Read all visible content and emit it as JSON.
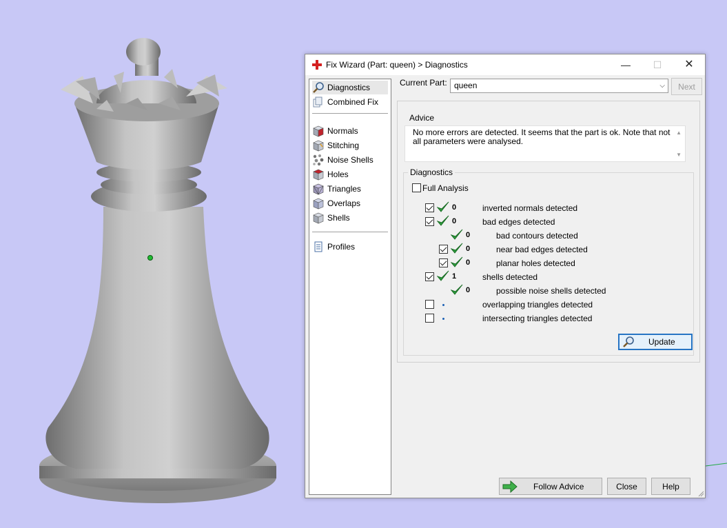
{
  "window": {
    "title": "Fix Wizard (Part: queen) > Diagnostics",
    "minimize_glyph": "—",
    "maximize_glyph": "☐",
    "close_glyph": "✕"
  },
  "nav": {
    "items": [
      {
        "label": "Diagnostics",
        "icon": "magnifier-icon",
        "selected": true
      },
      {
        "label": "Combined Fix",
        "icon": "layers-icon"
      },
      {
        "label": "Normals",
        "icon": "cube-red-face-icon"
      },
      {
        "label": "Stitching",
        "icon": "cube-stitch-icon"
      },
      {
        "label": "Noise Shells",
        "icon": "noise-shells-icon"
      },
      {
        "label": "Holes",
        "icon": "cube-hole-icon"
      },
      {
        "label": "Triangles",
        "icon": "cube-triangles-icon"
      },
      {
        "label": "Overlaps",
        "icon": "cube-overlaps-icon"
      },
      {
        "label": "Shells",
        "icon": "cube-shells-icon"
      },
      {
        "label": "Profiles",
        "icon": "document-icon"
      }
    ]
  },
  "current_part": {
    "label": "Current Part:",
    "value": "queen",
    "dropdown_glyph": "⌵",
    "next_label": "Next"
  },
  "advice": {
    "title": "Advice",
    "text": "No more errors are detected. It seems that the part is ok. Note that not all parameters were analysed."
  },
  "diagnostics": {
    "title": "Diagnostics",
    "full_analysis_label": "Full Analysis",
    "full_analysis_checked": false,
    "rows": [
      {
        "label": "inverted normals detected",
        "count": "0",
        "checkbox": true,
        "checked": true,
        "status": "ok",
        "indent": 0
      },
      {
        "label": "bad edges detected",
        "count": "0",
        "checkbox": true,
        "checked": true,
        "status": "ok",
        "indent": 0
      },
      {
        "label": "bad contours detected",
        "count": "0",
        "checkbox": false,
        "checked": false,
        "status": "ok",
        "indent": 1
      },
      {
        "label": "near bad edges detected",
        "count": "0",
        "checkbox": true,
        "checked": true,
        "status": "ok",
        "indent": 1
      },
      {
        "label": "planar holes detected",
        "count": "0",
        "checkbox": true,
        "checked": true,
        "status": "ok",
        "indent": 1
      },
      {
        "label": "shells detected",
        "count": "1",
        "checkbox": true,
        "checked": true,
        "status": "ok",
        "indent": 0
      },
      {
        "label": "possible noise shells detected",
        "count": "0",
        "checkbox": false,
        "checked": false,
        "status": "ok",
        "indent": 1
      },
      {
        "label": "overlapping triangles detected",
        "count": "",
        "checkbox": true,
        "checked": false,
        "status": "pending",
        "indent": 0
      },
      {
        "label": "intersecting triangles detected",
        "count": "",
        "checkbox": true,
        "checked": false,
        "status": "pending",
        "indent": 0
      }
    ],
    "update_label": "Update"
  },
  "footer": {
    "follow_advice_label": "Follow Advice",
    "close_label": "Close",
    "help_label": "Help"
  },
  "colors": {
    "viewport_background": "#c8c8f6",
    "model_gray": "#a6a6a6",
    "check_green": "#2e9e3e",
    "accent_blue": "#2674c4",
    "title_icon_red": "#d42020"
  }
}
